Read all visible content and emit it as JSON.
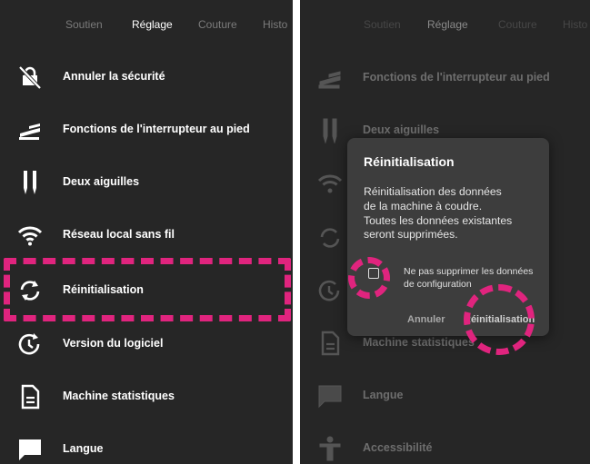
{
  "left_screen": {
    "tabs": [
      "Soutien",
      "Réglage",
      "Couture",
      "Histo"
    ],
    "active_tab": "Réglage",
    "items": [
      {
        "label": "Annuler la sécurité",
        "icon": "lock-off-icon"
      },
      {
        "label": "Fonctions de l'interrupteur au pied",
        "icon": "foot-pedal-icon"
      },
      {
        "label": "Deux aiguilles",
        "icon": "twin-needle-icon"
      },
      {
        "label": "Réseau local sans fil",
        "icon": "wifi-icon"
      },
      {
        "label": "Réinitialisation",
        "icon": "reset-icon"
      },
      {
        "label": "Version du logiciel",
        "icon": "software-version-icon"
      },
      {
        "label": "Machine statistiques",
        "icon": "document-icon"
      },
      {
        "label": "Langue",
        "icon": "chat-bubble-icon"
      }
    ]
  },
  "right_screen": {
    "tabs": [
      "Soutien",
      "Réglage",
      "Couture",
      "Histo"
    ],
    "active_tab": "Réglage",
    "items": [
      {
        "label": "Fonctions de l'interrupteur au pied",
        "icon": "foot-pedal-icon"
      },
      {
        "label": "Deux aiguilles",
        "icon": "twin-needle-icon"
      },
      {
        "label": "",
        "icon": "wifi-icon"
      },
      {
        "label": "",
        "icon": "reset-icon"
      },
      {
        "label": "",
        "icon": "software-version-icon"
      },
      {
        "label": "Machine statistiques",
        "icon": "document-icon"
      },
      {
        "label": "Langue",
        "icon": "chat-bubble-icon"
      },
      {
        "label": "Accessibilité",
        "icon": "accessibility-icon"
      }
    ]
  },
  "dialog": {
    "title": "Réinitialisation",
    "message_lines": [
      "Réinitialisation des données",
      "de la machine à coudre.",
      "Toutes les données existantes",
      "seront supprimées."
    ],
    "checkbox_label_lines": [
      "Ne pas supprimer les données",
      "de configuration"
    ],
    "checkbox_checked": false,
    "cancel_label": "Annuler",
    "confirm_label": "Réinitialisation"
  },
  "colors": {
    "background": "#262626",
    "dialog": "#3d3d3d",
    "highlight": "#e0247e",
    "text": "#ffffff"
  }
}
